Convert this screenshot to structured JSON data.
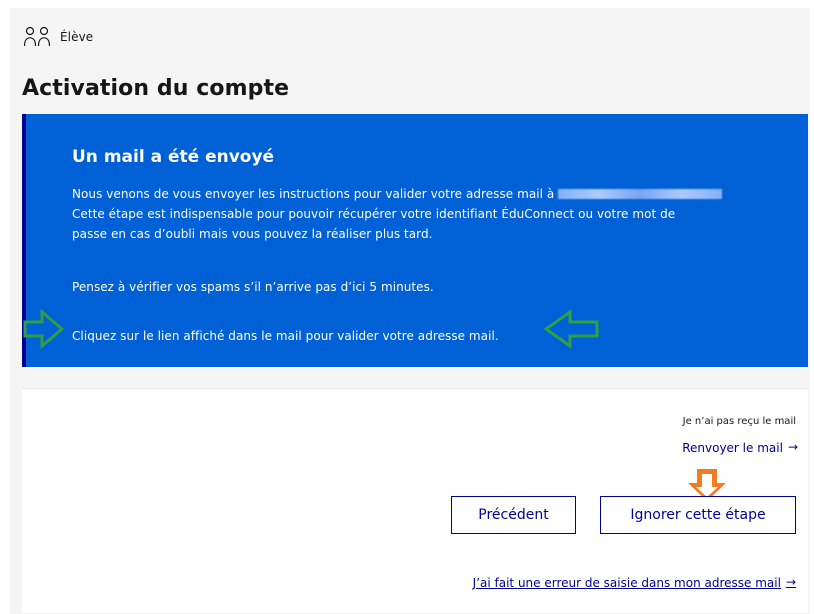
{
  "header": {
    "role_label": "Élève",
    "role_icon": "users-outline-icon"
  },
  "page": {
    "title": "Activation du compte"
  },
  "info": {
    "title": "Un mail a été envoyé",
    "paragraph_1_start": "Nous venons de vous envoyer les instructions pour valider votre adresse mail à",
    "email_display": "[redacted]",
    "paragraph_1_line_2": "Cette étape est indispensable pour pouvoir récupérer votre identifiant ÉduConnect ou votre mot de",
    "paragraph_1_line_3": "passe en cas d’oubli mais vous pouvez la réaliser plus tard.",
    "paragraph_2": "Pensez à vérifier vos spams s’il n’arrive pas d’ici 5 minutes.",
    "paragraph_3": "Cliquez sur le lien affiché dans le mail pour valider votre adresse mail.",
    "highlight_arrow_color": "#2f9e44"
  },
  "actions": {
    "not_received_label": "Je n’ai pas reçu le mail",
    "resend_label": "Renvoyer le mail",
    "resend_icon": "arrow-right-icon",
    "skip_arrow_color": "#f47b20",
    "previous_button": "Précédent",
    "skip_button": "Ignorer cette étape",
    "input_error_link": "J’ai fait une erreur de saisie dans mon adresse mail",
    "input_error_icon": "arrow-right-icon"
  },
  "colors": {
    "panel_blue": "#0060d6",
    "panel_border": "#000091",
    "link_blue": "#000091",
    "page_background": "#f5f5f5"
  }
}
